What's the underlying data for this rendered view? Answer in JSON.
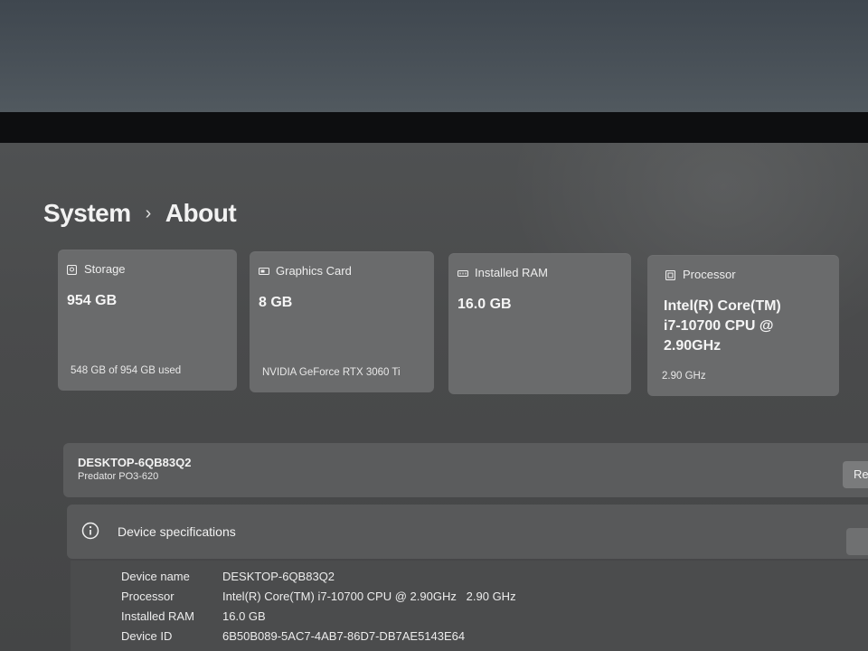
{
  "breadcrumb": {
    "parent": "System",
    "separator": "›",
    "current": "About"
  },
  "cards": [
    {
      "title": "Storage",
      "icon": "storage-icon",
      "value": "954 GB",
      "sub": "548 GB of 954 GB used"
    },
    {
      "title": "Graphics Card",
      "icon": "graphics-card-icon",
      "value": "8 GB",
      "sub": "NVIDIA GeForce RTX 3060 Ti"
    },
    {
      "title": "Installed RAM",
      "icon": "ram-icon",
      "value": "16.0 GB",
      "sub": ""
    },
    {
      "title": "Processor",
      "icon": "processor-icon",
      "value_lines": [
        "Intel(R) Core(TM)",
        "i7-10700 CPU @",
        "2.90GHz"
      ],
      "sub": "2.90 GHz"
    }
  ],
  "device": {
    "name": "DESKTOP-6QB83Q2",
    "model": "Predator PO3-620",
    "rename_label": "Re"
  },
  "specs": {
    "title": "Device specifications",
    "rows": [
      {
        "label": "Device name",
        "value": "DESKTOP-6QB83Q2"
      },
      {
        "label": "Processor",
        "value": "Intel(R) Core(TM) i7-10700 CPU @ 2.90GHz   2.90 GHz"
      },
      {
        "label": "Installed RAM",
        "value": "16.0 GB"
      },
      {
        "label": "Device ID",
        "value": "6B50B089-5AC7-4AB7-86D7-DB7AE5143E64"
      }
    ]
  },
  "colors": {
    "card_bg": "#6a6b6c",
    "screen_bg": "#4a4b4c",
    "text": "#f2f2f2"
  }
}
